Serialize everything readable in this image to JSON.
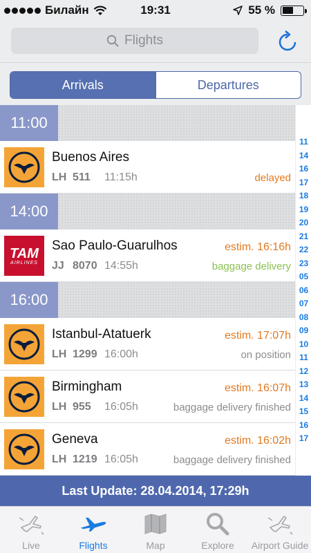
{
  "status_bar": {
    "carrier": "Билайн",
    "time": "19:31",
    "battery": "55 %",
    "battery_level": 0.55
  },
  "search": {
    "placeholder": "Flights"
  },
  "segments": {
    "arrivals": "Arrivals",
    "departures": "Departures",
    "selected": "Arrivals"
  },
  "groups": [
    {
      "hour": "11:00",
      "flights": [
        {
          "city": "Buenos Aires",
          "airline": "LH",
          "number": "511",
          "time": "11:15h",
          "status_top": "",
          "status_bottom": "delayed",
          "logo": "lufthansa-crane"
        }
      ]
    },
    {
      "hour": "14:00",
      "flights": [
        {
          "city": "Sao Paulo-Guarulhos",
          "airline": "JJ",
          "number": "8070",
          "time": "14:55h",
          "status_top": "estim. 16:16h",
          "status_bottom": "baggage delivery",
          "logo": "tam-airlines"
        }
      ]
    },
    {
      "hour": "16:00",
      "flights": [
        {
          "city": "Istanbul-Atatuerk",
          "airline": "LH",
          "number": "1299",
          "time": "16:00h",
          "status_top": "estim. 17:07h",
          "status_bottom": "on position",
          "logo": "lufthansa-crane"
        },
        {
          "city": "Birmingham",
          "airline": "LH",
          "number": "955",
          "time": "16:05h",
          "status_top": "estim. 16:07h",
          "status_bottom": "baggage delivery finished",
          "logo": "lufthansa-crane"
        },
        {
          "city": "Geneva",
          "airline": "LH",
          "number": "1219",
          "time": "16:05h",
          "status_top": "estim. 16:02h",
          "status_bottom": "baggage delivery finished",
          "logo": "lufthansa-crane"
        }
      ]
    }
  ],
  "tam_logo_text": {
    "main": "TAM",
    "sub": "AIRLINES"
  },
  "index": [
    "11",
    "14",
    "16",
    "17",
    "18",
    "19",
    "20",
    "21",
    "22",
    "23",
    "05",
    "06",
    "07",
    "08",
    "09",
    "10",
    "11",
    "12",
    "13",
    "14",
    "15",
    "16",
    "17"
  ],
  "footer": {
    "last_update": "Last Update: 28.04.2014, 17:29h"
  },
  "tabs": [
    {
      "label": "Live",
      "icon": "plane-burst-icon",
      "active": false
    },
    {
      "label": "Flights",
      "icon": "airplane-icon",
      "active": true
    },
    {
      "label": "Map",
      "icon": "map-icon",
      "active": false
    },
    {
      "label": "Explore",
      "icon": "magnifier-icon",
      "active": false
    },
    {
      "label": "Airport Guide",
      "icon": "airport-guide-icon",
      "active": false
    }
  ],
  "colors": {
    "accent": "#4f68ad",
    "hour_header": "#8a97c9",
    "status_orange": "#e07a21",
    "status_green": "#8cc152",
    "index_blue": "#1a7be0",
    "lufthansa_yellow": "#f4a436",
    "tam_red": "#c8102e"
  }
}
